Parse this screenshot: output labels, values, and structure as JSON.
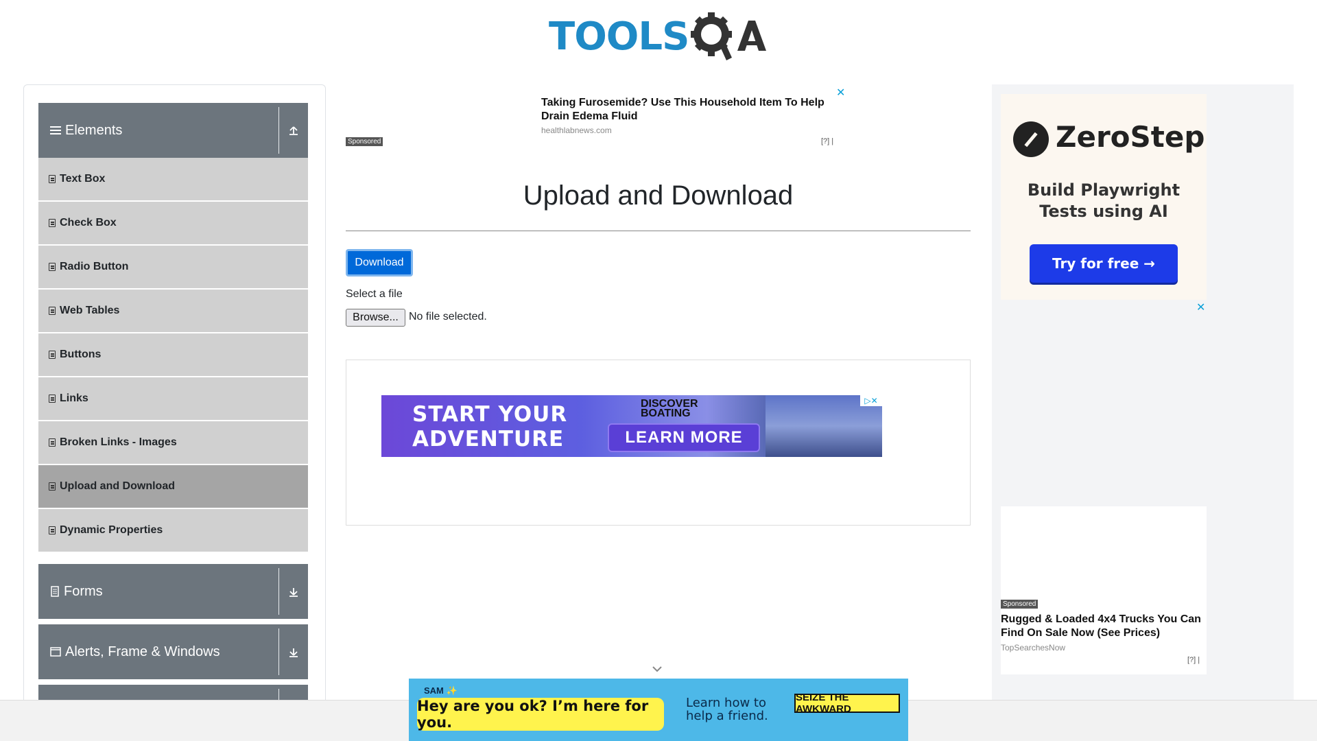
{
  "header": {
    "logo_text": "TOOLSQA"
  },
  "sidebar": {
    "groups": [
      {
        "title": "Elements",
        "expanded": true
      },
      {
        "title": "Forms",
        "expanded": false
      },
      {
        "title": "Alerts, Frame & Windows",
        "expanded": false
      }
    ],
    "items": [
      {
        "label": "Text Box"
      },
      {
        "label": "Check Box"
      },
      {
        "label": "Radio Button"
      },
      {
        "label": "Web Tables"
      },
      {
        "label": "Buttons"
      },
      {
        "label": "Links"
      },
      {
        "label": "Broken Links - Images"
      },
      {
        "label": "Upload and Download",
        "active": true
      },
      {
        "label": "Dynamic Properties"
      }
    ]
  },
  "top_ad": {
    "sponsored": "Sponsored",
    "headline": "Taking Furosemide? Use This Household Item To Help Drain Edema Fluid",
    "source": "healthlabnews.com",
    "close": "✕",
    "info": "[?] |"
  },
  "main": {
    "title": "Upload and Download",
    "download_label": "Download",
    "select_label": "Select a file",
    "browse_label": "Browse...",
    "file_status": "No file selected."
  },
  "banner_ad": {
    "headline_1": "START YOUR",
    "headline_2": "ADVENTURE",
    "brand_1": "DISCOVER",
    "brand_2": "BOATING",
    "cta": "LEARN MORE",
    "adchoice": "▷✕"
  },
  "right_ads": {
    "zerostep": {
      "name": "ZeroStep",
      "tagline_1": "Build Playwright",
      "tagline_2": "Tests using AI",
      "cta": "Try for free →"
    },
    "close": "✕",
    "trucks": {
      "sponsored": "Sponsored",
      "headline": "Rugged & Loaded 4x4 Trucks You Can Find On Sale Now (See Prices)",
      "source": "TopSearchesNow",
      "info": "[?] |"
    }
  },
  "bottom_ad": {
    "brand": "SAM ✨",
    "message": "Hey are you ok? I’m here for you.",
    "learn_1": "Learn how to",
    "learn_2": "help a friend.",
    "campaign": "SEIZE THE AWKWARD"
  },
  "colors": {
    "accent": "#0069d9",
    "sidebar_header": "#6c757d",
    "sidebar_item": "#d0d0d0",
    "sidebar_active": "#a5a5a5",
    "logo_blue": "#1f8ac6"
  }
}
